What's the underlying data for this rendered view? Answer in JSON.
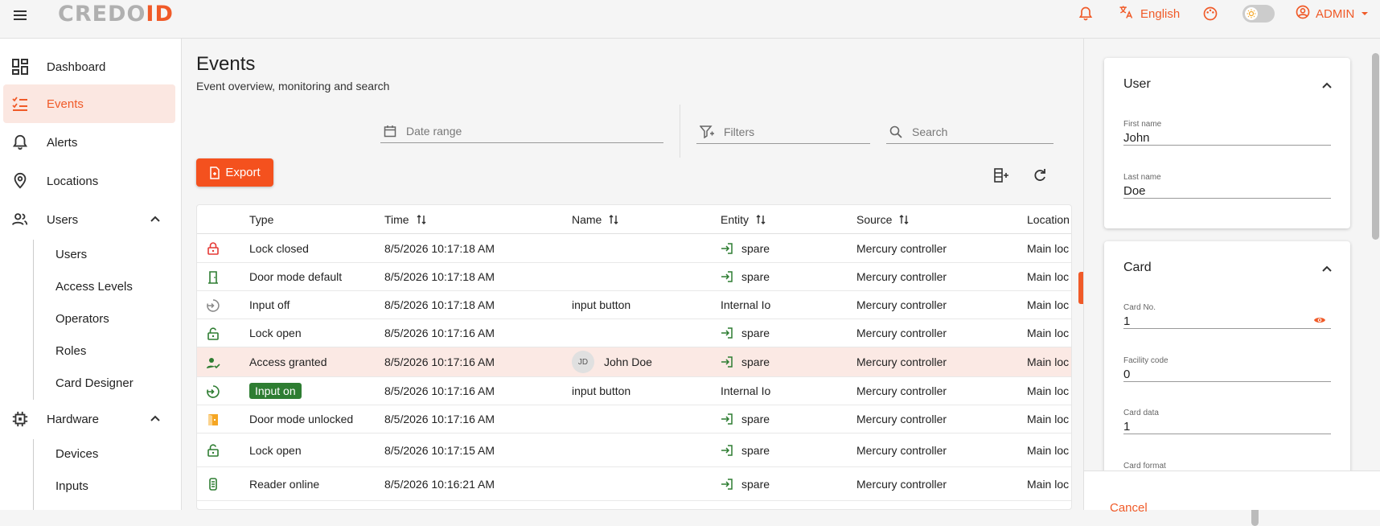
{
  "app": {
    "logo_part1": "CREDO",
    "logo_part2": "ID",
    "language": "English",
    "user": "ADMIN"
  },
  "colors": {
    "accent": "#f05a28",
    "success": "#2e7d32",
    "warning": "#f5a623"
  },
  "sidebar": {
    "items": [
      {
        "label": "Dashboard",
        "icon": "dashboard-icon"
      },
      {
        "label": "Events",
        "icon": "events-list-icon",
        "active": true
      },
      {
        "label": "Alerts",
        "icon": "bell-icon"
      },
      {
        "label": "Locations",
        "icon": "location-pin-icon"
      },
      {
        "label": "Users",
        "icon": "people-icon",
        "expanded": true
      },
      {
        "label": "Hardware",
        "icon": "chip-icon",
        "expanded": true
      }
    ],
    "users_sub": [
      "Users",
      "Access Levels",
      "Operators",
      "Roles",
      "Card Designer"
    ],
    "hardware_sub": [
      "Devices",
      "Inputs"
    ]
  },
  "main": {
    "title": "Events",
    "subtitle": "Event overview, monitoring and search",
    "date_range_placeholder": "Date range",
    "filters_placeholder": "Filters",
    "search_placeholder": "Search",
    "export_label": "Export"
  },
  "table": {
    "columns": [
      "Type",
      "Time",
      "Name",
      "Entity",
      "Source",
      "Location"
    ],
    "rows": [
      {
        "icon": "lock-closed-icon",
        "type": "Lock closed",
        "time": "8/5/2026 10:17:18 AM",
        "name": "",
        "entity": "spare",
        "source": "Mercury controller",
        "location": "Main loc"
      },
      {
        "icon": "door-icon",
        "type": "Door mode default",
        "time": "8/5/2026 10:17:18 AM",
        "name": "",
        "entity": "spare",
        "source": "Mercury controller",
        "location": "Main loc"
      },
      {
        "icon": "input-off-icon",
        "type": "Input off",
        "time": "8/5/2026 10:17:18 AM",
        "name": "input button",
        "entity": "Internal Io",
        "source": "Mercury controller",
        "location": "Main loc"
      },
      {
        "icon": "lock-open-icon",
        "type": "Lock open",
        "time": "8/5/2026 10:17:16 AM",
        "name": "",
        "entity": "spare",
        "source": "Mercury controller",
        "location": "Main loc"
      },
      {
        "icon": "access-granted-icon",
        "type": "Access granted",
        "time": "8/5/2026 10:17:16 AM",
        "name": "John Doe",
        "initials": "JD",
        "entity": "spare",
        "source": "Mercury controller",
        "location": "Main loc",
        "selected": true
      },
      {
        "icon": "input-on-icon",
        "type": "Input on",
        "time": "8/5/2026 10:17:16 AM",
        "name": "input button",
        "entity": "Internal Io",
        "source": "Mercury controller",
        "location": "Main loc",
        "badge": true
      },
      {
        "icon": "door-unlocked-icon",
        "type": "Door mode unlocked",
        "time": "8/5/2026 10:17:16 AM",
        "name": "",
        "entity": "spare",
        "source": "Mercury controller",
        "location": "Main loc"
      },
      {
        "icon": "lock-open-icon",
        "type": "Lock open",
        "time": "8/5/2026 10:17:15 AM",
        "name": "",
        "entity": "spare",
        "source": "Mercury controller",
        "location": "Main loc"
      },
      {
        "icon": "reader-online-icon",
        "type": "Reader online",
        "time": "8/5/2026 10:16:21 AM",
        "name": "",
        "entity": "spare",
        "source": "Mercury controller",
        "location": "Main loc"
      }
    ]
  },
  "user_card": {
    "title": "User",
    "first_name_label": "First name",
    "first_name": "John",
    "last_name_label": "Last name",
    "last_name": "Doe"
  },
  "card_card": {
    "title": "Card",
    "card_no_label": "Card No.",
    "card_no": "1",
    "facility_label": "Facility code",
    "facility": "0",
    "card_data_label": "Card data",
    "card_data": "1",
    "card_format_label": "Card format"
  },
  "footer": {
    "cancel_label": "Cancel"
  }
}
